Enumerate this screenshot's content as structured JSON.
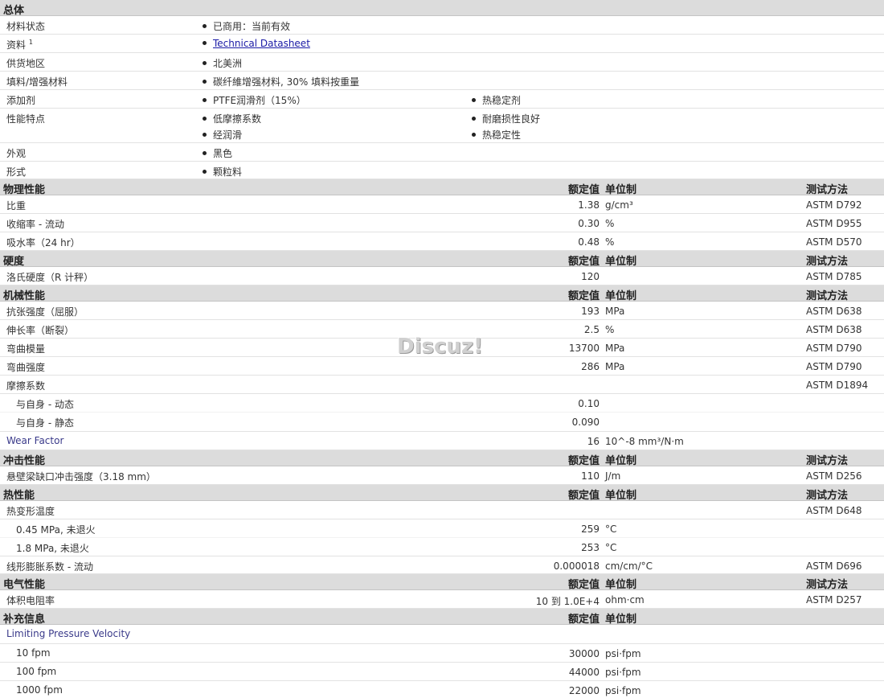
{
  "general": {
    "title": "总体",
    "rows": [
      {
        "label": "材料状态",
        "bullets": [
          "已商用：当前有效"
        ]
      },
      {
        "label": "资料",
        "sup": "1",
        "link": "Technical Datasheet"
      },
      {
        "label": "供货地区",
        "bullets": [
          "北美洲"
        ]
      },
      {
        "label": "填料/增强材料",
        "bullets": [
          "碳纤維增强材料, 30% 填料按重量"
        ]
      },
      {
        "label": "添加剂",
        "bullets": [
          "PTFE润滑剂（15%）",
          "热稳定剂"
        ]
      },
      {
        "label": "性能特点",
        "bullets": [
          "低摩擦系数",
          "耐磨损性良好",
          "经润滑",
          "热稳定性"
        ]
      },
      {
        "label": "外观",
        "bullets": [
          "黑色"
        ]
      },
      {
        "label": "形式",
        "bullets": [
          "颗粒料"
        ]
      }
    ]
  },
  "headers": {
    "value": "额定值",
    "unit": "单位制",
    "test": "测试方法"
  },
  "physical": {
    "title": "物理性能",
    "rows": [
      {
        "label": "比重",
        "value": "1.38",
        "unit": "g/cm³",
        "test": "ASTM D792"
      },
      {
        "label": "收缩率  - 流动",
        "value": "0.30",
        "unit": "%",
        "test": "ASTM D955"
      },
      {
        "label": "吸水率（24 hr）",
        "value": "0.48",
        "unit": "%",
        "test": "ASTM D570"
      }
    ]
  },
  "hardness": {
    "title": "硬度",
    "rows": [
      {
        "label": "洛氏硬度（R 计秤）",
        "value": "120",
        "unit": "",
        "test": "ASTM D785"
      }
    ]
  },
  "mechanical": {
    "title": "机械性能",
    "rows": [
      {
        "label": "抗张强度（屈服）",
        "value": "193",
        "unit": "MPa",
        "test": "ASTM D638"
      },
      {
        "label": "伸长率（断裂）",
        "value": "2.5",
        "unit": "%",
        "test": "ASTM D638"
      },
      {
        "label": "弯曲模量",
        "value": "13700",
        "unit": "MPa",
        "test": "ASTM D790"
      },
      {
        "label": "弯曲强度",
        "value": "286",
        "unit": "MPa",
        "test": "ASTM D790"
      },
      {
        "label": "摩擦系数",
        "value": "",
        "unit": "",
        "test": "ASTM D1894"
      },
      {
        "label": "与自身  - 动态",
        "value": "0.10",
        "unit": "",
        "test": ""
      },
      {
        "label": "与自身  - 静态",
        "value": "0.090",
        "unit": "",
        "test": ""
      },
      {
        "label": "Wear Factor",
        "value": "16",
        "unit": "10^-8 mm³/N·m",
        "test": ""
      }
    ]
  },
  "impact": {
    "title": "冲击性能",
    "rows": [
      {
        "label": "悬壁梁缺口冲击强度（3.18 mm）",
        "value": "110",
        "unit": "J/m",
        "test": "ASTM D256"
      }
    ]
  },
  "thermal": {
    "title": "热性能",
    "rows": [
      {
        "label": "热变形温度",
        "value": "",
        "unit": "",
        "test": "ASTM D648"
      },
      {
        "label": "0.45 MPa, 未退火",
        "value": "259",
        "unit": "°C",
        "test": ""
      },
      {
        "label": "1.8 MPa, 未退火",
        "value": "253",
        "unit": "°C",
        "test": ""
      },
      {
        "label": "线形膨胀系数  - 流动",
        "value": "0.000018",
        "unit": "cm/cm/°C",
        "test": "ASTM D696"
      }
    ]
  },
  "electrical": {
    "title": "电气性能",
    "rows": [
      {
        "label": "体积电阻率",
        "value": "10 到  1.0E+4",
        "unit": "ohm·cm",
        "test": "ASTM D257"
      }
    ]
  },
  "supplemental": {
    "title": "补充信息",
    "rows": [
      {
        "label": "Limiting Pressure Velocity",
        "value": "",
        "unit": "",
        "test": ""
      },
      {
        "label": "10 fpm",
        "value": "30000",
        "unit": "psi·fpm",
        "test": ""
      },
      {
        "label": "100 fpm",
        "value": "44000",
        "unit": "psi·fpm",
        "test": ""
      },
      {
        "label": "1000 fpm",
        "value": "22000",
        "unit": "psi·fpm",
        "test": ""
      }
    ]
  },
  "watermark": "Discuz!"
}
